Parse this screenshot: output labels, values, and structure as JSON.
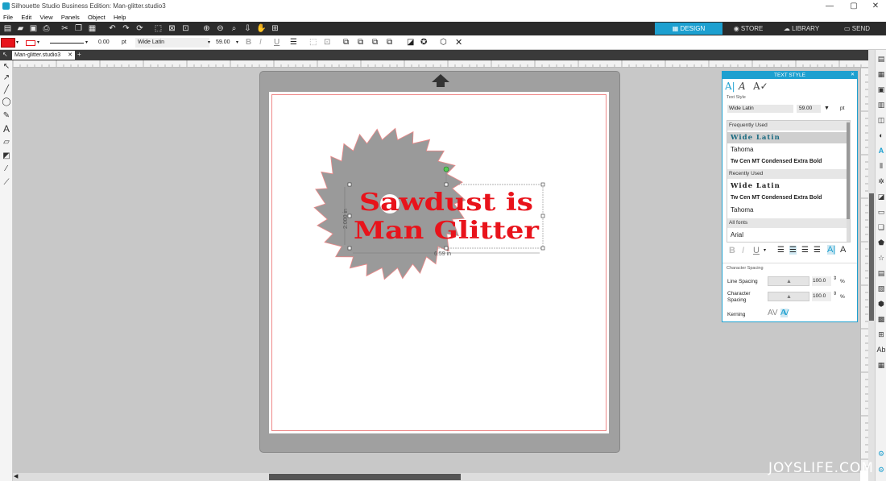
{
  "window": {
    "title": "Silhouette Studio Business Edition: Man-glitter.studio3",
    "controls": [
      "—",
      "▢",
      "✕"
    ]
  },
  "menu": [
    "File",
    "Edit",
    "View",
    "Panels",
    "Object",
    "Help"
  ],
  "nav_tabs": [
    {
      "label": "DESIGN",
      "active": true
    },
    {
      "label": "STORE",
      "active": false
    },
    {
      "label": "LIBRARY",
      "active": false
    },
    {
      "label": "SEND",
      "active": false
    }
  ],
  "toolbar2": {
    "line_width": "0.00",
    "line_unit": "pt",
    "font_name": "Wide Latin",
    "font_size": "59.00",
    "size_unit": "pt"
  },
  "document_tab": "Man-glitter.studio3",
  "new_tab": "+",
  "canvas": {
    "text_line1": "Sawdust is",
    "text_line2": "Man Glitter",
    "height_label": "2.000 in",
    "width_label": "6.59 in"
  },
  "text_style_panel": {
    "title": "TEXT STYLE",
    "section_text_style": "Text Style",
    "font_field": "Wide Latin",
    "size_field": "59.00",
    "size_unit": "pt",
    "frequently_used_header": "Frequently Used",
    "frequently_used": [
      "Wide Latin",
      "Tahoma",
      "Tw Cen MT Condensed Extra Bold"
    ],
    "recently_used_header": "Recently Used",
    "recently_used": [
      "Wide Latin",
      "Tw Cen MT Condensed Extra Bold",
      "Tahoma"
    ],
    "all_fonts_header": "All fonts",
    "all_fonts": [
      "Arial"
    ],
    "section_character_spacing": "Character Spacing",
    "line_spacing_label": "Line Spacing",
    "line_spacing_value": "100.0",
    "char_spacing_label": "Character Spacing",
    "char_spacing_value": "100.0",
    "percent": "%",
    "kerning_label": "Kerning"
  },
  "watermark": "JOYSLIFE.COM",
  "colors": {
    "accent": "#1da0d0",
    "text_red": "#e8131b",
    "saw_gray": "#9a9a9a",
    "toolbar_dark": "#2b2b2b"
  }
}
